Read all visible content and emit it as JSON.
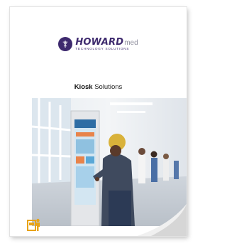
{
  "logo": {
    "brand": "HOWARD",
    "sub": "med",
    "tagline": "TECHNOLOGY SOLUTIONS",
    "brand_color": "#3e2a6e"
  },
  "title": {
    "bold": "Kiosk",
    "rest": " Solutions"
  },
  "icons": {
    "logo_mark": "caduceus-icon",
    "kiosk": "kiosk-user-icon",
    "accent": "#e8a317"
  }
}
